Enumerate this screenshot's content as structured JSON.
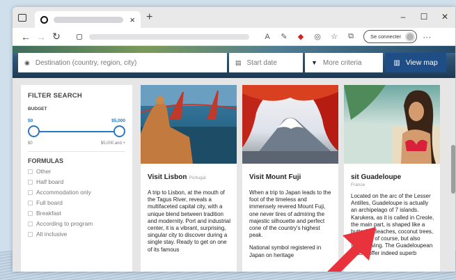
{
  "browser": {
    "tab_close": "×",
    "new_tab": "+",
    "connect_label": "Se connecter",
    "window_controls": [
      "–",
      "☐",
      "✕"
    ]
  },
  "search": {
    "destination_placeholder": "Destination (country, region, city)",
    "start_date": "Start date",
    "more_criteria": "More criteria",
    "view_map": "View map"
  },
  "filter": {
    "title": "FILTER SEARCH",
    "budget_label": "BUDGET",
    "price_min": "$0",
    "price_max": "$5,000",
    "range_min": "$0",
    "range_max": "$5,000 and +",
    "budget_min_fraction": 0,
    "budget_max_fraction": 1,
    "formulas_title": "FORMULAS",
    "formulas": [
      "Other",
      "Half board",
      "Accommodation only",
      "Full board",
      "Breakfast",
      "According to program",
      "All inclusive"
    ]
  },
  "cards": [
    {
      "title": "Visit Lisbon",
      "location": "Portugal",
      "text": "A trip to Lisbon, at the mouth of the Tagus River, reveals a multifaceted capital city, with a unique blend between tradition and modernity. Port and industrial center, it is a vibrant, surprising, singular city to discover during a single stay. Ready to get on one of its famous"
    },
    {
      "title": "Visit Mount Fuji",
      "location": "",
      "text": "When a trip to Japan leads to the foot of the timeless and immensely revered Mount Fuji, one never tires of admiring the majestic silhouette and perfect cone of the country's highest peak.",
      "text2": "National symbol registered in Japan on heritage"
    },
    {
      "title": "sit Guadeloupe",
      "location": "France",
      "text": "Located on the arc of the Lesser Antilles, Guadeloupe is actually an archipelago of 7 islands. Karukera, as it is called in Creole, the main part, is shaped like a butterfly. Beaches, coconut trees, sun, yes, of course, but also scuba diving. The Guadeloupean coasts offer indeed superb"
    }
  ],
  "colors": {
    "accent": "#2a77c9",
    "map_button": "#1f4e86",
    "arrow": "#e8323c"
  }
}
